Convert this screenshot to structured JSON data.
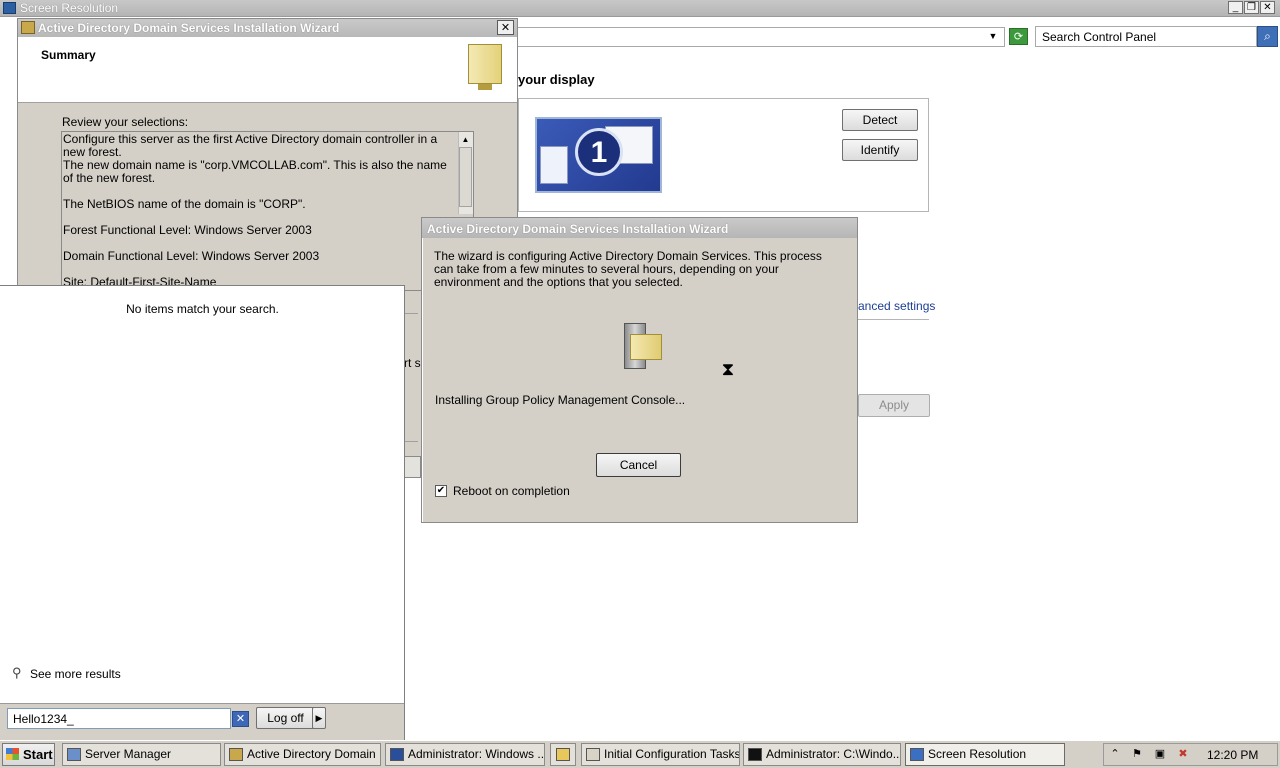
{
  "screen_resolution": {
    "window_title": "Screen Resolution",
    "search_placeholder": "Search Control Panel",
    "heading": "your display",
    "monitor_number": "1",
    "detect_label": "Detect",
    "identify_label": "Identify",
    "advanced_settings": "anced settings",
    "apply_label": "Apply"
  },
  "wizard": {
    "title": "Active Directory Domain Services Installation Wizard",
    "header_title": "Summary",
    "review_label": "Review your selections:",
    "summary_lines": [
      "Configure this server as the first Active Directory domain controller in a new forest.",
      "The new domain name is \"corp.VMCOLLAB.com\". This is also the name of the new forest.",
      "The NetBIOS name of the domain is \"CORP\".",
      "Forest Functional Level: Windows Server 2003",
      "Domain Functional Level: Windows Server 2003",
      "Site: Default-First-Site-Name"
    ],
    "partial_text": "rt se"
  },
  "start_menu": {
    "no_items": "No items match your search.",
    "see_more": "See more results",
    "search_value": "Hello1234_",
    "logoff_label": "Log off"
  },
  "progress_dialog": {
    "title": "Active Directory Domain Services Installation Wizard",
    "message": "The wizard is configuring Active Directory Domain Services. This process can take from a few minutes to several hours, depending on your environment and the options that you selected.",
    "status": "Installing Group Policy Management Console...",
    "cancel_label": "Cancel",
    "reboot_label": "Reboot on completion",
    "reboot_checked": true
  },
  "taskbar": {
    "start_label": "Start",
    "buttons": [
      "Server Manager",
      "Active Directory Domain ...",
      "Administrator: Windows ...",
      "",
      "Initial Configuration Tasks",
      "Administrator: C:\\Windo...",
      "Screen Resolution"
    ],
    "clock": "12:20 PM"
  },
  "colors": {
    "dialog_bg": "#d4d0c8",
    "title_text": "#ffffff",
    "link_blue": "#1c3f94"
  }
}
